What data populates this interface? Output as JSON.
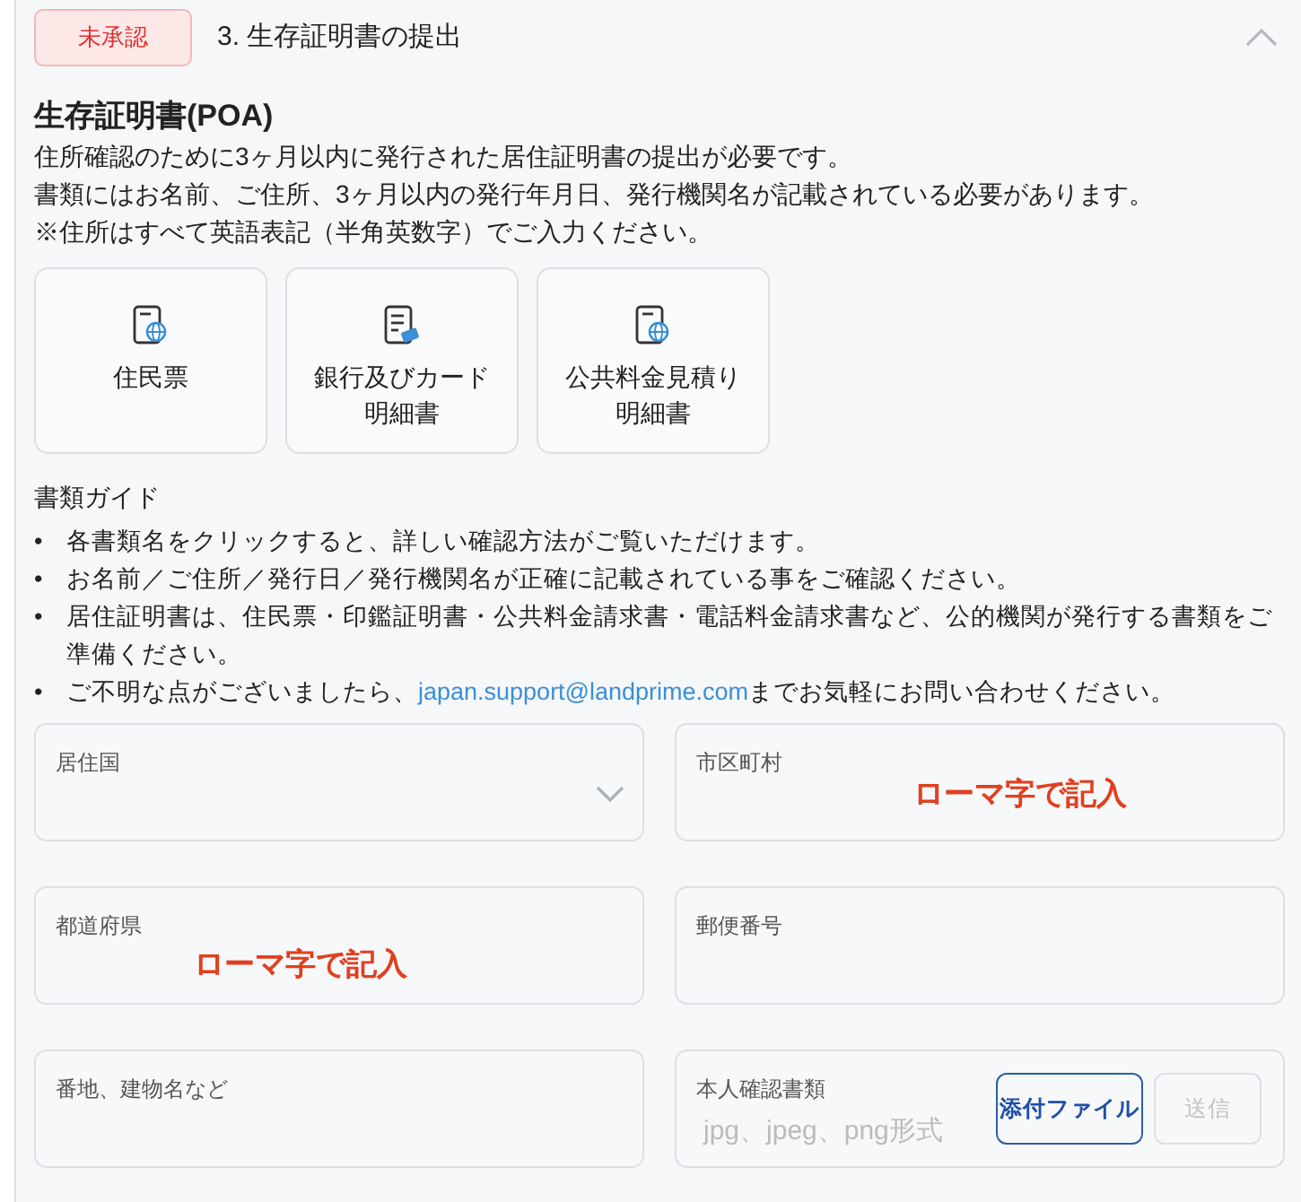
{
  "step": {
    "status": "未承認",
    "title": "3. 生存証明書の提出",
    "expanded": true
  },
  "heading": "生存証明書(POA)",
  "intro": [
    "住所確認のために3ヶ月以内に発行された居住証明書の提出が必要です。",
    "書類にはお名前、ご住所、3ヶ月以内の発行年月日、発行機関名が記載されている必要があります。",
    "※住所はすべて英語表記（半角英数字）でご入力ください。"
  ],
  "documents": [
    {
      "label": "住民票",
      "kind": "globe"
    },
    {
      "label": "銀行及びカード明細書",
      "kind": "card"
    },
    {
      "label": "公共料金見積り明細書",
      "kind": "globe"
    }
  ],
  "guide": {
    "title": "書類ガイド",
    "bullets": [
      {
        "marker": "•",
        "text": "各書類名をクリックすると、詳しい確認方法がご覧いただけます。"
      },
      {
        "marker": "•",
        "text": "お名前／ご住所／発行日／発行機関名が正確に記載されている事をご確認ください。"
      },
      {
        "marker": "•",
        "text": "居住証明書は、住民票・印鑑証明書・公共料金請求書・電話料金請求書など、公的機関が発行する書類をご準備ください。"
      },
      {
        "marker": "•",
        "text": "ご不明な点がございましたら、",
        "link": "japan.support@landprime.com",
        "after": "までお気軽にお問い合わせください。"
      }
    ]
  },
  "fields": [
    {
      "kind": "select",
      "label": "居住国"
    },
    {
      "kind": "text",
      "label": "市区町村",
      "annotation": "ローマ字で記入"
    },
    {
      "kind": "text",
      "label": "都道府県",
      "annotation": "ローマ字で記入"
    },
    {
      "kind": "text",
      "label": "郵便番号"
    },
    {
      "kind": "text",
      "label": "番地、建物名など"
    },
    {
      "kind": "file",
      "label": "本人確認書類",
      "placeholder": "jpg、jpeg、png形式",
      "attach": "添付ファイル",
      "send": "送信",
      "send_disabled": true
    }
  ]
}
